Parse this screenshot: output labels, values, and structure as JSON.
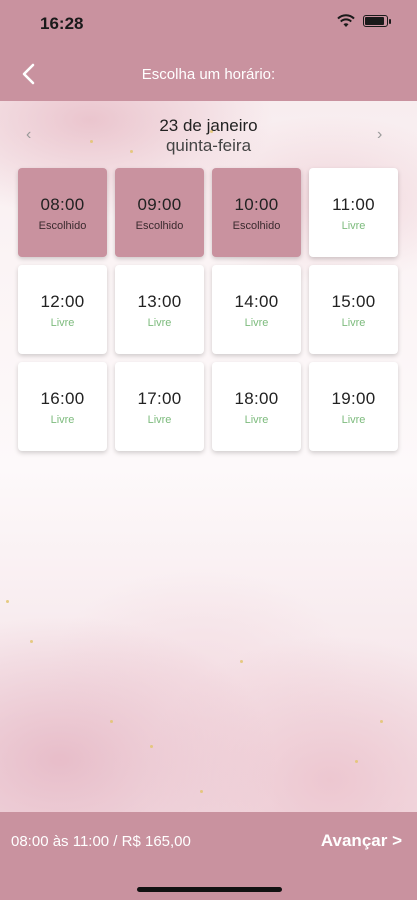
{
  "status_bar": {
    "time": "16:28"
  },
  "header": {
    "title": "Escolha um horário:"
  },
  "date": {
    "day": "23 de janeiro",
    "weekday": "quinta-feira",
    "prev_icon": "‹",
    "next_icon": "›"
  },
  "slots": [
    {
      "time": "08:00",
      "status": "Escolhido",
      "chosen": true
    },
    {
      "time": "09:00",
      "status": "Escolhido",
      "chosen": true
    },
    {
      "time": "10:00",
      "status": "Escolhido",
      "chosen": true
    },
    {
      "time": "11:00",
      "status": "Livre",
      "chosen": false
    },
    {
      "time": "12:00",
      "status": "Livre",
      "chosen": false
    },
    {
      "time": "13:00",
      "status": "Livre",
      "chosen": false
    },
    {
      "time": "14:00",
      "status": "Livre",
      "chosen": false
    },
    {
      "time": "15:00",
      "status": "Livre",
      "chosen": false
    },
    {
      "time": "16:00",
      "status": "Livre",
      "chosen": false
    },
    {
      "time": "17:00",
      "status": "Livre",
      "chosen": false
    },
    {
      "time": "18:00",
      "status": "Livre",
      "chosen": false
    },
    {
      "time": "19:00",
      "status": "Livre",
      "chosen": false
    }
  ],
  "footer": {
    "summary": "08:00 às 11:00 / R$ 165,00",
    "next_label": "Avançar >"
  },
  "colors": {
    "accent": "#c9929f",
    "free": "#7dbb7d"
  }
}
